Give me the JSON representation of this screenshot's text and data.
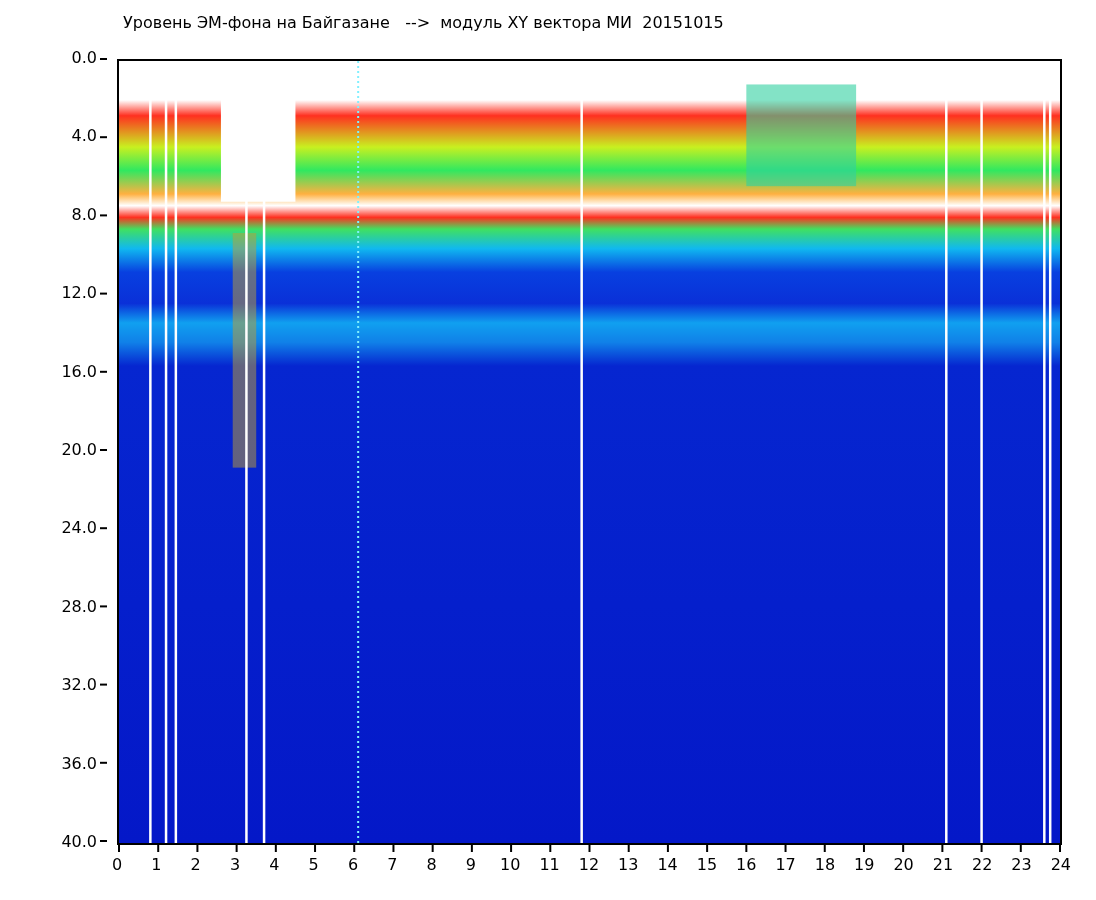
{
  "title": "Уровень ЭМ-фона на Байгазане   -->  модуль XY вектора МИ  20151015",
  "y_axis": {
    "ticks": [
      "0.0",
      "4.0",
      "8.0",
      "12.0",
      "16.0",
      "20.0",
      "24.0",
      "28.0",
      "32.0",
      "36.0",
      "40.0"
    ]
  },
  "x_axis": {
    "ticks": [
      "0",
      "1",
      "2",
      "3",
      "4",
      "5",
      "6",
      "7",
      "8",
      "9",
      "10",
      "11",
      "12",
      "13",
      "14",
      "15",
      "16",
      "17",
      "18",
      "19",
      "20",
      "21",
      "22",
      "23",
      "24"
    ]
  }
}
